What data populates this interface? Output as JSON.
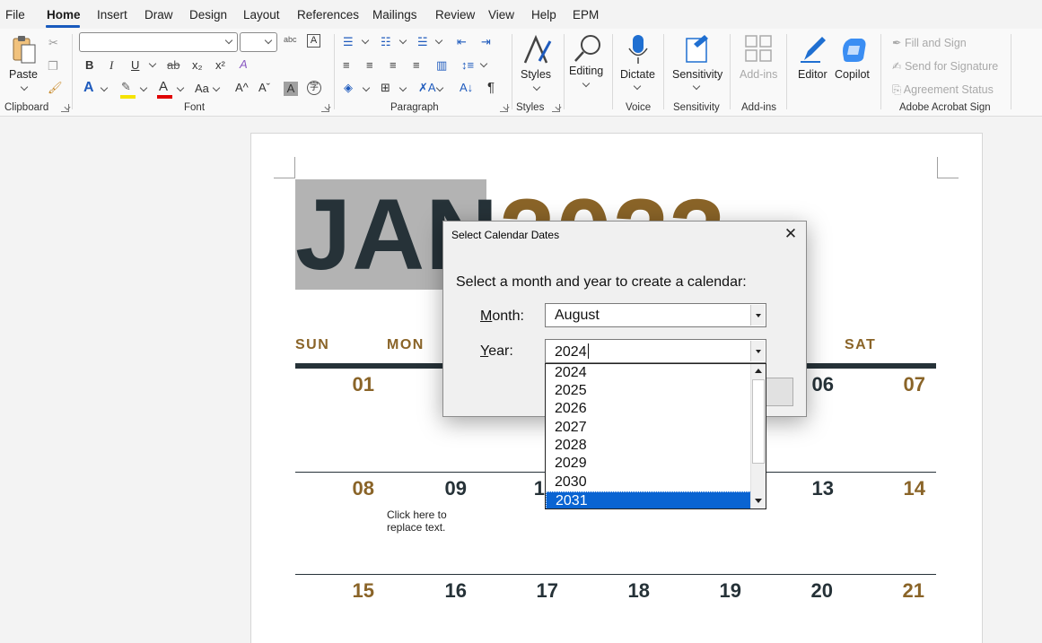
{
  "menu": {
    "items": [
      "File",
      "Home",
      "Insert",
      "Draw",
      "Design",
      "Layout",
      "References",
      "Mailings",
      "Review",
      "View",
      "Help",
      "EPM"
    ],
    "active": "Home"
  },
  "ribbon": {
    "clipboard": {
      "label": "Clipboard",
      "paste": "Paste"
    },
    "font": {
      "label": "Font",
      "bold": "B",
      "italic": "I",
      "underline": "U",
      "strike": "ab",
      "sub": "x₂",
      "sup": "x²",
      "case": "Aa",
      "grow": "A^",
      "shrink": "Aˇ",
      "text_effects": "A",
      "font_color": "A",
      "highlight_color": "#f5e300",
      "font_color_bar": "#e00000"
    },
    "paragraph": {
      "label": "Paragraph",
      "pilcrow": "¶"
    },
    "styles": {
      "label": "Styles",
      "button": "Styles"
    },
    "editing": {
      "button": "Editing"
    },
    "voice": {
      "label": "Voice",
      "button": "Dictate"
    },
    "sensitivity": {
      "label": "Sensitivity",
      "button": "Sensitivity"
    },
    "addins": {
      "label": "Add-ins",
      "button": "Add-ins"
    },
    "editor": {
      "button": "Editor"
    },
    "copilot": {
      "button": "Copilot"
    },
    "acrobat": {
      "label": "Adobe Acrobat Sign",
      "fill_sign": "Fill and Sign",
      "send_sig": "Send for Signature",
      "agreement": "Agreement Status"
    }
  },
  "document": {
    "month_title": "JAN",
    "year_title": "2023",
    "days_of_week": [
      "SUN",
      "MON",
      "SAT"
    ],
    "week1": [
      "01",
      "06",
      "07"
    ],
    "week2": [
      "08",
      "09",
      "1",
      "13",
      "14"
    ],
    "week3": [
      "15",
      "16",
      "17",
      "18",
      "19",
      "20",
      "21"
    ],
    "placeholder_line1": "Click here to",
    "placeholder_line2": "replace text."
  },
  "dialog": {
    "title": "Select Calendar Dates",
    "close": "✕",
    "prompt": "Select a month and year to create a calendar:",
    "month_label_first": "M",
    "month_label_rest": "onth:",
    "year_label_first": "Y",
    "year_label_rest": "ear:",
    "month_value": "August",
    "year_value": "2024",
    "year_options": [
      "2024",
      "2025",
      "2026",
      "2027",
      "2028",
      "2029",
      "2030",
      "2031"
    ],
    "selected_year": "2031",
    "selection_color": "#0a64d2"
  },
  "colors": {
    "accent_gold": "#8a6428",
    "dark_slate": "#263238",
    "word_blue": "#185abd"
  }
}
